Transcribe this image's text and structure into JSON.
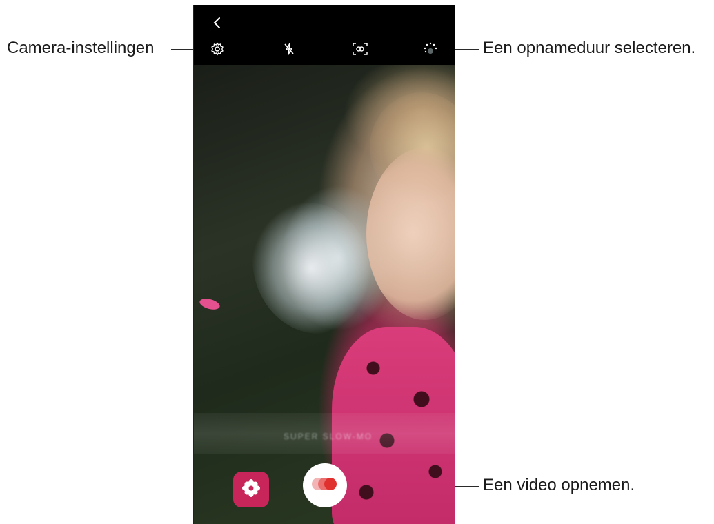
{
  "callouts": {
    "settings": "Camera-instellingen",
    "duration": "Een opnameduur selecteren.",
    "record": "Een video opnemen."
  },
  "topbar": {
    "icons": [
      "back-icon",
      "settings-icon",
      "flash-off-icon",
      "auto-detect-icon",
      "duration-icon"
    ]
  },
  "viewfinder": {
    "mode_label": "SUPER SLOW-MO"
  },
  "controls": {
    "effect_icon": "flower-icon",
    "record_icon": "record-icon",
    "accent_color": "#c8265a",
    "record_color": "#e0312f"
  }
}
